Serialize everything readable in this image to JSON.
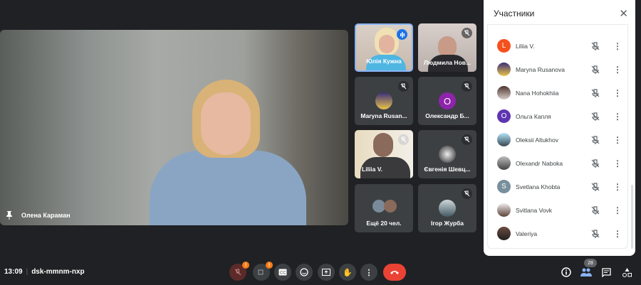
{
  "main_video": {
    "name": "Олена Караман"
  },
  "tiles": [
    {
      "name": "Юлія Кужна",
      "speaking": true
    },
    {
      "name": "Людмила Нов..."
    },
    {
      "name": "Maryna Rusan..."
    },
    {
      "name": "Олександр Б...",
      "initial": "О"
    },
    {
      "name": "Liliia V."
    },
    {
      "name": "Євгенія Шевц..."
    },
    {
      "name": "Ещё 20 чел."
    },
    {
      "name": "Ігор Журба"
    }
  ],
  "panel": {
    "title": "Участники",
    "participants": [
      {
        "name": "Liliia V.",
        "initial": "L",
        "color": "#f4511e"
      },
      {
        "name": "Maryna Rusanova"
      },
      {
        "name": "Nana Hohokhiia"
      },
      {
        "name": "Ольга Капля",
        "initial": "О",
        "color": "#5e35b1"
      },
      {
        "name": "Oleksii Altukhov"
      },
      {
        "name": "Olexandr Naboka"
      },
      {
        "name": "Svetlana Khobta",
        "initial": "S",
        "color": "#78909c"
      },
      {
        "name": "Svitlana Vovk"
      },
      {
        "name": "Valeriya"
      }
    ]
  },
  "bottom": {
    "time": "13:09",
    "meeting_code": "dsk-mmnm-nxp",
    "participant_count": "28",
    "alert": "!"
  },
  "colors": {
    "bg": "#202124",
    "end_call": "#ea4335",
    "accent": "#8ab4f8",
    "warning": "#fa7b17"
  }
}
